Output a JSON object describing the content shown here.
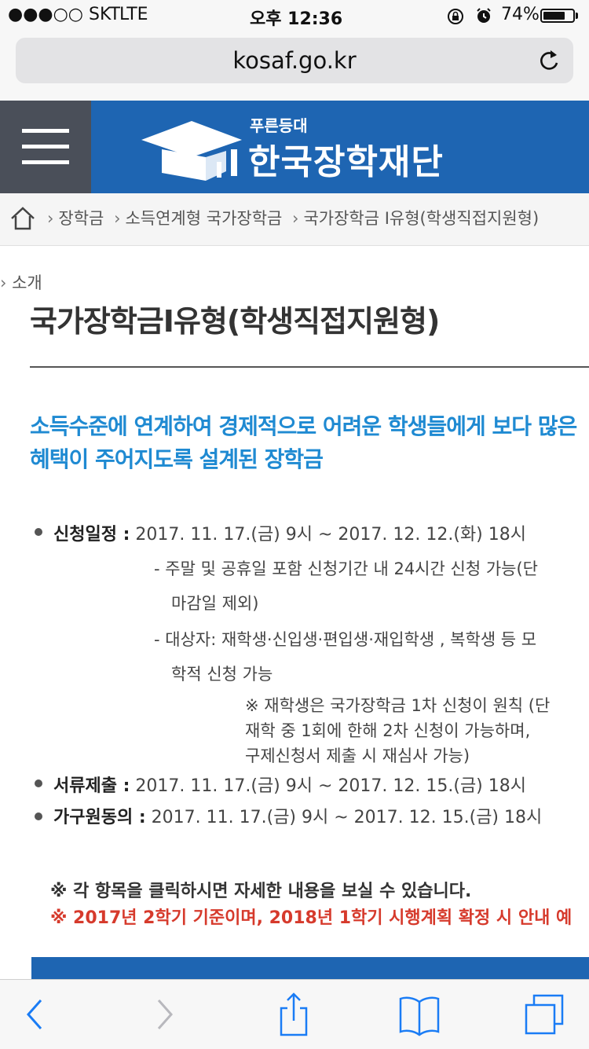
{
  "status_bar": {
    "carrier": "●●●○○ SKT",
    "network": "LTE",
    "time": "오후 12:36",
    "battery": "74%",
    "battery_level": 0.74
  },
  "browser": {
    "url": "kosaf.go.kr"
  },
  "header": {
    "logo_small": "푸른등대",
    "logo_main": "한국장학재단"
  },
  "breadcrumb": {
    "items": [
      "장학금",
      "소득연계형 국가장학금",
      "국가장학금 I유형(학생직접지원형)"
    ]
  },
  "content": {
    "section_label": "소개",
    "title": "국가장학금I유형(학생직접지원형)",
    "intro_line1": "소득수준에 연계하여 경제적으로 어려운 학생들에게 보다 많은",
    "intro_line2": "혜택이 주어지도록 설계된 장학금",
    "schedule": {
      "label": "신청일정 :",
      "value": "2017. 11. 17.(금) 9시 ~ 2017. 12. 12.(화) 18시",
      "note1_a": "- 주말 및 공휴일 포함 신청기간 내 24시간 신청 가능(단",
      "note1_b": "마감일 제외)",
      "note2_a": "- 대상자: 재학생·신입생·편입생·재입학생 , 복학생 등 모",
      "note2_b": "학적 신청 가능",
      "remark_a": "※ 재학생은 국가장학금 1차 신청이 원칙 (단",
      "remark_b": "재학 중 1회에 한해 2차 신청이 가능하며,",
      "remark_c": "구제신청서 제출 시 재심사 가능)"
    },
    "documents": {
      "label": "서류제출 :",
      "value": "2017. 11. 17.(금) 9시 ~ 2017. 12. 15.(금) 18시"
    },
    "consent": {
      "label": "가구원동의 :",
      "value": "2017. 11. 17.(금) 9시 ~ 2017. 12. 15.(금) 18시"
    },
    "notice1": "※ 각 항목을 클릭하시면 자세한 내용을 보실 수 있습니다.",
    "notice2": "※ 2017년 2학기 기준이며, 2018년 1학기 시행계획 확정 시 안내 예"
  },
  "colors": {
    "brand_blue": "#1e65b2",
    "menu_gray": "#4a4f59",
    "intro_blue": "#1f8ad2",
    "notice_red": "#d63a2c",
    "ios_blue": "#1a7cf5"
  },
  "icons": [
    "menu-icon",
    "home-icon",
    "reload-icon",
    "back-icon",
    "forward-icon",
    "share-icon",
    "bookmarks-icon",
    "tabs-icon",
    "lock-rotation-icon",
    "alarm-icon"
  ]
}
